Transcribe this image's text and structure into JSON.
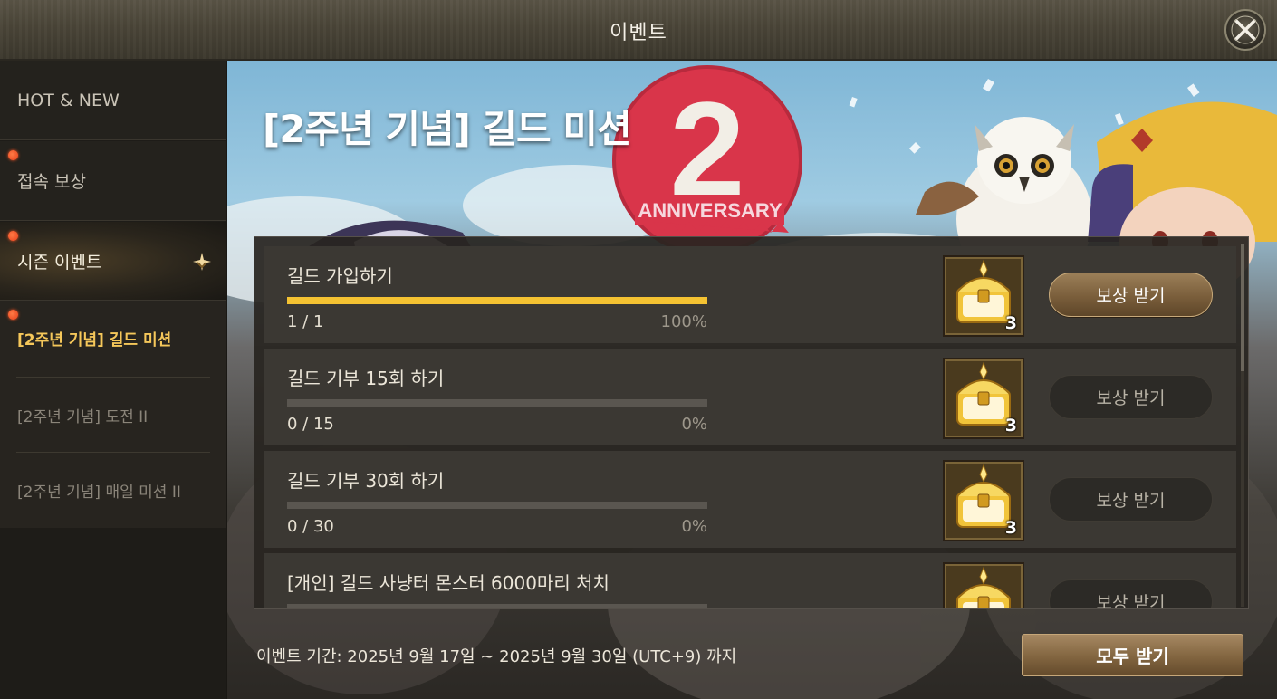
{
  "window": {
    "title": "이벤트",
    "close_icon": "close-x-icon"
  },
  "sidebar": {
    "items": [
      {
        "label": "HOT & NEW",
        "badge": false
      },
      {
        "label": "접속 보상",
        "badge": true
      },
      {
        "label": "시즌 이벤트",
        "badge": true,
        "expanded": true
      }
    ],
    "sub_items": [
      {
        "label": "[2주년 기념] 길드 미션",
        "badge": true,
        "active": true
      },
      {
        "label": "[2주년 기념] 도전 II",
        "badge": false,
        "active": false
      },
      {
        "label": "[2주년 기념] 매일 미션 II",
        "badge": false,
        "active": false
      }
    ]
  },
  "banner": {
    "title": "[2주년 기념] 길드 미션",
    "logo_number": "2",
    "logo_text": "ANNIVERSARY"
  },
  "missions": [
    {
      "title": "길드 가입하기",
      "progress": "1 / 1",
      "percent": "100%",
      "fill": 1.0,
      "reward_icon": "golden-chest-icon",
      "reward_qty": "3",
      "button": "보상 받기",
      "claimable": true
    },
    {
      "title": "길드 기부 15회 하기",
      "progress": "0 / 15",
      "percent": "0%",
      "fill": 0.0,
      "reward_icon": "golden-chest-icon",
      "reward_qty": "3",
      "button": "보상 받기",
      "claimable": false
    },
    {
      "title": "길드 기부 30회 하기",
      "progress": "0 / 30",
      "percent": "0%",
      "fill": 0.0,
      "reward_icon": "golden-chest-icon",
      "reward_qty": "3",
      "button": "보상 받기",
      "claimable": false
    },
    {
      "title": "[개인] 길드 사냥터 몬스터 6000마리 처치",
      "progress": "",
      "percent": "",
      "fill": 0.0,
      "reward_icon": "golden-chest-icon",
      "reward_qty": "",
      "button": "보상 받기",
      "claimable": false
    }
  ],
  "footer": {
    "period": "이벤트 기간: 2025년 9월 17일 ~ 2025년 9월 30일 (UTC+9) 까지",
    "claim_all": "모두 받기"
  },
  "colors": {
    "progress_fill": "#f4c232",
    "accent_gold": "#f5c75a",
    "badge_red": "#e8401b",
    "button_brown": "#826540"
  }
}
